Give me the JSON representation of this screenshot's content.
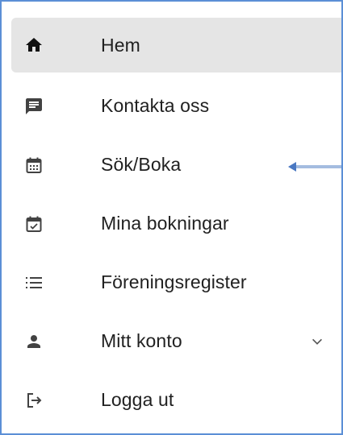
{
  "menu": {
    "items": [
      {
        "label": "Hem",
        "icon": "home-icon",
        "active": true
      },
      {
        "label": "Kontakta oss",
        "icon": "message-icon"
      },
      {
        "label": "Sök/Boka",
        "icon": "calendar-grid-icon"
      },
      {
        "label": "Mina bokningar",
        "icon": "calendar-check-icon"
      },
      {
        "label": "Föreningsregister",
        "icon": "list-icon"
      },
      {
        "label": "Mitt konto",
        "icon": "person-icon",
        "expandable": true
      },
      {
        "label": "Logga ut",
        "icon": "logout-icon"
      }
    ]
  },
  "colors": {
    "frame_border": "#5b8fd6",
    "active_background": "#e5e5e5",
    "icon": "#424242",
    "annotation_arrow": "#4a78c2"
  }
}
